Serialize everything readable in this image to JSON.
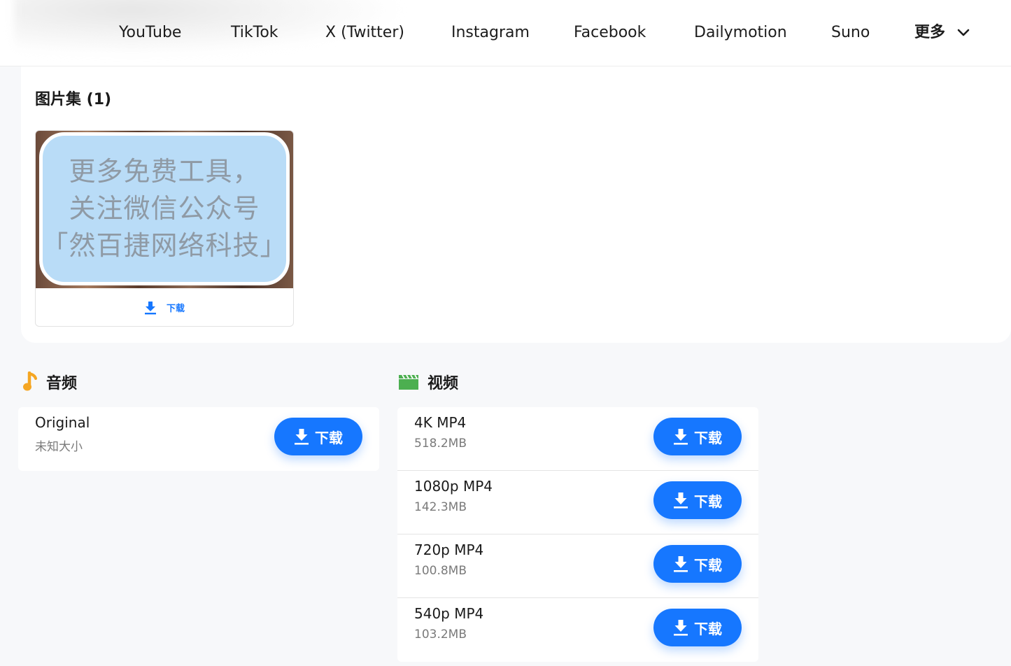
{
  "nav": {
    "items": [
      "YouTube",
      "TikTok",
      "X (Twitter)",
      "Instagram",
      "Facebook",
      "Dailymotion",
      "Suno"
    ],
    "more_label": "更多"
  },
  "gallery": {
    "title": "图片集 (1)",
    "thumbnail_lines": [
      "更多免费工具，",
      "关注微信公众号",
      "「然百捷网络科技」"
    ],
    "download_label": "下载"
  },
  "audio": {
    "heading": "音频",
    "rows": [
      {
        "name": "Original",
        "size": "未知大小",
        "button": "下载"
      }
    ]
  },
  "video": {
    "heading": "视频",
    "rows": [
      {
        "name": "4K MP4",
        "size": "518.2MB",
        "button": "下载"
      },
      {
        "name": "1080p MP4",
        "size": "142.3MB",
        "button": "下载"
      },
      {
        "name": "720p MP4",
        "size": "100.8MB",
        "button": "下载"
      },
      {
        "name": "540p MP4",
        "size": "103.2MB",
        "button": "下载"
      }
    ]
  },
  "colors": {
    "accent": "#1677ff",
    "audio_icon": "#f5a623",
    "video_icon": "#4caf50",
    "thumb_bubble": "#b9dcf7"
  },
  "icons": {
    "download": "download-icon",
    "audio": "music-note-icon",
    "video": "clapperboard-icon",
    "more": "chevron-down-icon"
  }
}
